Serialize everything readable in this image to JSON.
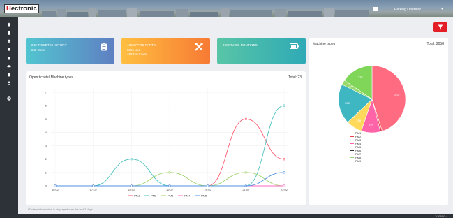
{
  "app": {
    "logo_prefix": "H",
    "logo_rest": "ectronic",
    "user_name": "Parking Operator",
    "user_caret": "▾"
  },
  "cards": [
    {
      "line1": "242 TICKETS HISTORY",
      "line2": "242 Done",
      "icon": "clipboard-icon"
    },
    {
      "line1": "466 SPARE PARTS",
      "line2": "58 In Use\n408 Not In use",
      "line2a": "58 In Use",
      "line2b": "408 Not In use",
      "icon": "tools-icon"
    },
    {
      "line1": "0 SERVICE ROUTINES",
      "line2": "",
      "icon": "battery-icon"
    }
  ],
  "colors": {
    "accent_red": "#e41e26",
    "sidebar": "#2d3138"
  },
  "line_panel": {
    "title": "Open tickets/ Machine types",
    "total": "Total: 23",
    "footnote": "*Tickets information is displayed over the last 7 days"
  },
  "pie_panel": {
    "title": "Machine types",
    "total": "Total: 2058"
  },
  "footer": {
    "text": "© 2022 ..."
  },
  "chart_data": [
    {
      "type": "line",
      "x": [
        "16:02",
        "17:02",
        "18:02",
        "19:02",
        "20:02",
        "21:02",
        "22:02"
      ],
      "ylim": [
        0,
        7
      ],
      "yticks": [
        0,
        1,
        2,
        3,
        4,
        5,
        6,
        7
      ],
      "series": [
        {
          "name": "PM1",
          "color": "#ff5a6e",
          "values": [
            0,
            0,
            0,
            0,
            0,
            5,
            2
          ]
        },
        {
          "name": "PM2",
          "color": "#4bc0c0",
          "values": [
            0,
            0,
            2,
            0,
            0,
            0,
            6
          ]
        },
        {
          "name": "PM3",
          "color": "#9fd26a",
          "values": [
            0,
            0,
            0,
            1,
            0,
            1,
            0
          ]
        },
        {
          "name": "PM4",
          "color": "#ff63c4",
          "values": [
            0,
            0,
            0,
            0,
            0,
            0,
            0
          ]
        },
        {
          "name": "PM5",
          "color": "#4a90e2",
          "values": [
            0,
            0,
            0,
            0,
            0,
            0,
            1
          ]
        }
      ]
    },
    {
      "type": "pie",
      "categories": [
        "PM1",
        "PM2",
        "PM3",
        "PM4",
        "PM5",
        "PM6",
        "PM7",
        "PM8",
        "PM9"
      ],
      "values": [
        928,
        18,
        0,
        190,
        158,
        1,
        398,
        47,
        318
      ],
      "colors": [
        "#ff6b81",
        "#e6414d",
        "#f58231",
        "#ff63a8",
        "#ffd95c",
        "#2f3640",
        "#3eb7c2",
        "#99d96b",
        "#7fd659"
      ],
      "slice_labels": [
        "928",
        "18",
        "",
        "190",
        "158",
        "1",
        "398",
        "47",
        "318"
      ]
    }
  ]
}
